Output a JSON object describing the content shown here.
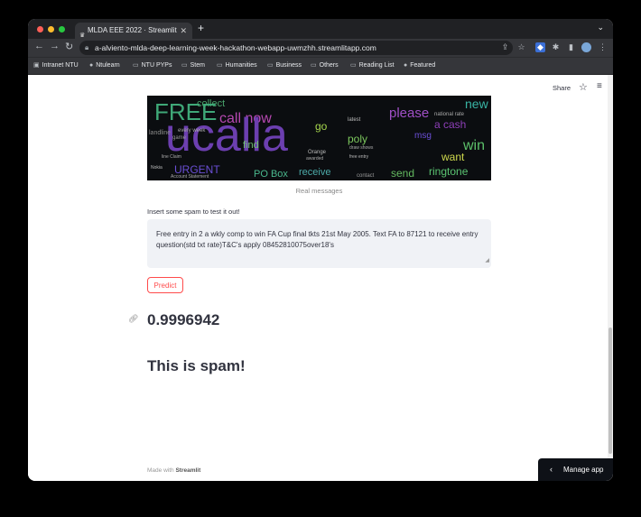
{
  "browser": {
    "tab_title": "MLDA EEE 2022 · Streamlit",
    "tab_icon": "streamlit-crown-icon",
    "url": "a-alviento-mlda-deep-learning-week-hackathon-webapp-uwmzhh.streamlitapp.com",
    "bookmarks": [
      {
        "label": "Intranet NTU",
        "icon": "ntu-icon"
      },
      {
        "label": "Ntulearn",
        "icon": "globe-icon"
      },
      {
        "label": "NTU PYPs",
        "icon": "folder-icon"
      },
      {
        "label": "Stem",
        "icon": "folder-icon"
      },
      {
        "label": "Humanities",
        "icon": "folder-icon"
      },
      {
        "label": "Business",
        "icon": "folder-icon"
      },
      {
        "label": "Others",
        "icon": "folder-icon"
      },
      {
        "label": "Reading List",
        "icon": "folder-icon"
      },
      {
        "label": "Featured",
        "icon": "globe-icon"
      }
    ]
  },
  "header": {
    "share_label": "Share"
  },
  "wordcloud": {
    "caption": "Real messages",
    "words": [
      "collect",
      "call now",
      "please",
      "ucalla",
      "FREE",
      "new",
      "win",
      "URGENT",
      "PO Box",
      "receive",
      "send",
      "ringtone",
      "want",
      "a cash",
      "poly",
      "go",
      "find",
      "landline",
      "every week",
      "game",
      "latest",
      "national rate",
      "Orange",
      "draw shows",
      "free entry",
      "awarded",
      "contact",
      "Account Statement",
      "Nokia",
      "line Claim",
      "msg"
    ]
  },
  "form": {
    "label": "Insert some spam to test it out!",
    "input_value": "Free entry in 2 a wkly comp to win FA Cup final tkts 21st May 2005. Text FA to 87121 to receive entry question(std txt rate)T&C's apply 08452810075over18's",
    "button_label": "Predict"
  },
  "result": {
    "probability": "0.9996942",
    "verdict": "This is spam!"
  },
  "footer": {
    "prefix": "Made with",
    "brand": "Streamlit"
  },
  "manage_app": {
    "label": "Manage app"
  },
  "colors": {
    "accent": "#ff4b4b",
    "text": "#31333f",
    "input_bg": "#f0f2f6",
    "dark": "#0e1117"
  }
}
